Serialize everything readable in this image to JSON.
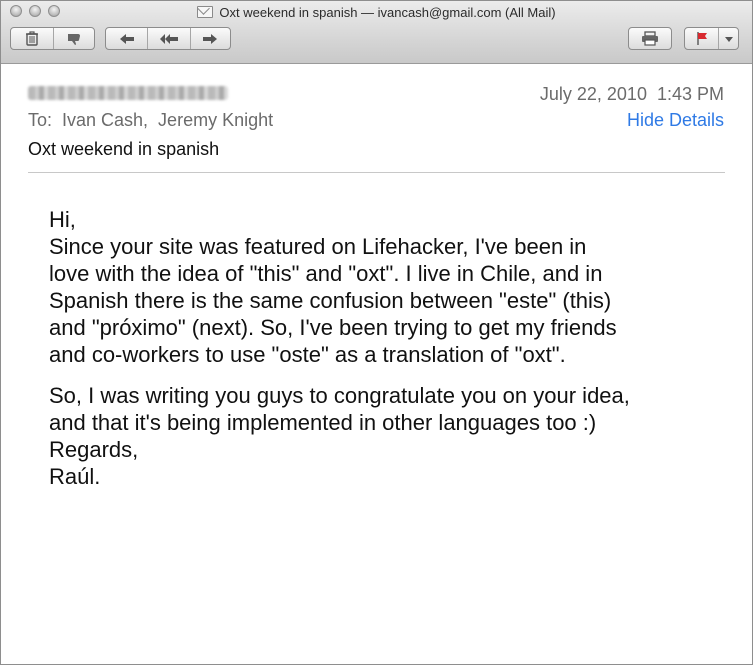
{
  "window": {
    "title": "Oxt weekend in spanish — ivancash@gmail.com (All Mail)"
  },
  "toolbar": {
    "delete": "trash-icon",
    "junk": "thumbs-down-icon",
    "reply": "reply-arrow-icon",
    "reply_all": "reply-all-icon",
    "forward": "forward-arrow-icon",
    "print": "printer-icon",
    "flag": "flag-icon"
  },
  "message": {
    "date": "July 22, 2010  1:43 PM",
    "to": "To:  Ivan Cash,  Jeremy Knight",
    "hide_details": "Hide Details",
    "subject": "Oxt weekend in spanish"
  },
  "body": {
    "p1": [
      "Hi,",
      "Since your site was featured on Lifehacker, I've been in",
      "love with the idea of \"this\" and \"oxt\". I live in Chile, and in",
      "Spanish there is the same confusion between \"este\" (this)",
      "and \"próximo\" (next). So, I've been trying to get my friends",
      "and co-workers to use \"oste\" as a translation of \"oxt\"."
    ],
    "p2": [
      "So, I was writing you guys to congratulate you on your idea,",
      "and that it's being implemented in other languages too :)",
      "Regards,",
      "Raúl."
    ]
  },
  "colors": {
    "link": "#2f7ae5",
    "meta_text": "#6b6b6b"
  }
}
